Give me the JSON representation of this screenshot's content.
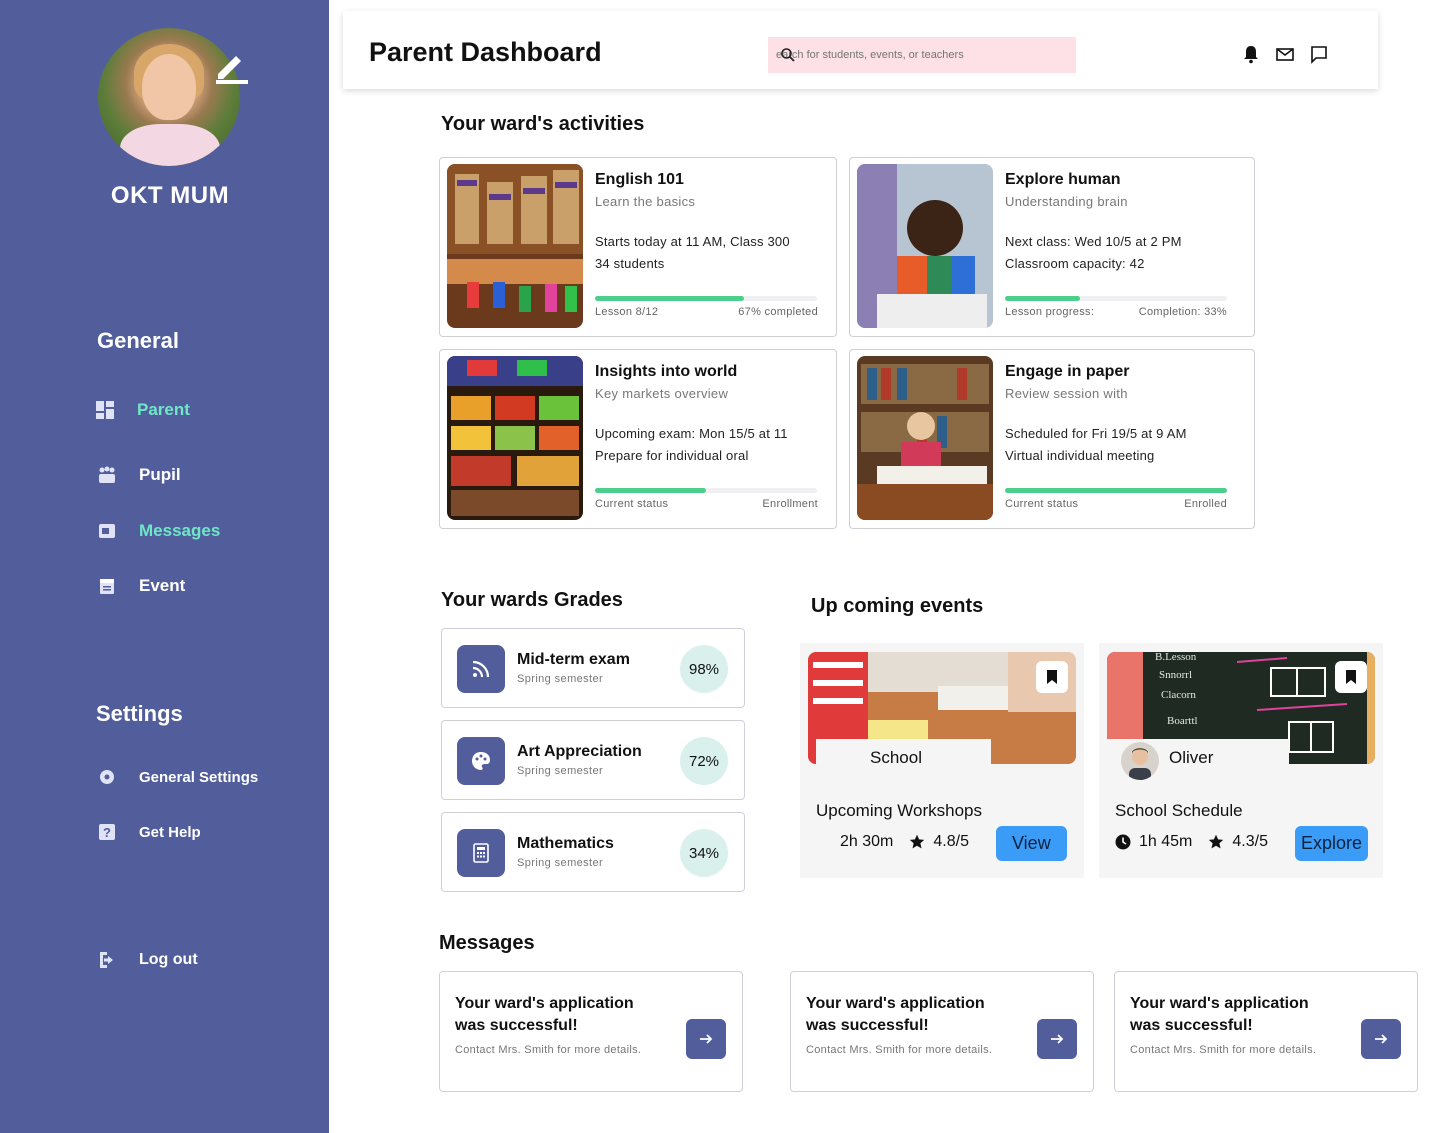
{
  "sidebar": {
    "profile_name": "OKT MUM",
    "general_title": "General",
    "nav": [
      {
        "label": "Parent",
        "icon": "dashboard-icon",
        "active": true
      },
      {
        "label": "Pupil",
        "icon": "group-icon",
        "active": false
      },
      {
        "label": "Messages",
        "icon": "messages-icon",
        "active": true
      },
      {
        "label": "Event",
        "icon": "calendar-icon",
        "active": false
      }
    ],
    "settings_title": "Settings",
    "settings": [
      {
        "label": "General Settings",
        "icon": "gear-icon"
      },
      {
        "label": "Get Help",
        "icon": "help-icon"
      }
    ],
    "logout_label": "Log out"
  },
  "header": {
    "title": "Parent Dashboard",
    "search_placeholder": "earch for students, events, or teachers"
  },
  "activities": {
    "title": "Your ward's activities",
    "items": [
      {
        "title": "English 101",
        "subtitle": "Learn the basics",
        "line1": "Starts today at 11 AM, Class 300",
        "line2": "34 students",
        "progress": 0.67,
        "foot_left": "Lesson 8/12",
        "foot_right": "67% completed"
      },
      {
        "title": "Explore human",
        "subtitle": "Understanding brain",
        "line1": "Next class: Wed 10/5 at 2 PM",
        "line2": "Classroom capacity: 42",
        "progress": 0.34,
        "foot_left": "Lesson progress:",
        "foot_right": "Completion: 33%"
      },
      {
        "title": "Insights into world",
        "subtitle": "Key markets overview",
        "line1": "Upcoming exam: Mon 15/5 at 11",
        "line2": "Prepare for individual oral",
        "progress": 0.5,
        "foot_left": "Current status",
        "foot_right": "Enrollment"
      },
      {
        "title": "Engage in paper",
        "subtitle": "Review session with",
        "line1": "Scheduled for Fri 19/5 at 9 AM",
        "line2": "Virtual individual meeting",
        "progress": 1.0,
        "foot_left": "Current status",
        "foot_right": "Enrolled"
      }
    ]
  },
  "grades": {
    "title": "Your wards Grades",
    "items": [
      {
        "title": "Mid-term exam",
        "subtitle": "Spring semester",
        "percent": "98%",
        "icon": "rss-icon"
      },
      {
        "title": "Art Appreciation",
        "subtitle": "Spring semester",
        "percent": "72%",
        "icon": "palette-icon"
      },
      {
        "title": "Mathematics",
        "subtitle": "Spring semester",
        "percent": "34%",
        "icon": "calculator-icon"
      }
    ]
  },
  "events": {
    "title": "Up coming events",
    "items": [
      {
        "label": "School",
        "name": "Upcoming Workshops",
        "duration": "2h 30m",
        "rating": "4.8/5",
        "button": "View"
      },
      {
        "label": "Oliver",
        "name": "School Schedule",
        "duration": "1h 45m",
        "rating": "4.3/5",
        "button": "Explore"
      }
    ]
  },
  "messages": {
    "title": "Messages",
    "items": [
      {
        "title": "Your ward's application was successful!",
        "body": "Contact Mrs. Smith for more details."
      },
      {
        "title": "Your ward's application was successful!",
        "body": "Contact Mrs. Smith for more details."
      },
      {
        "title": "Your ward's application was successful!",
        "body": "Contact Mrs. Smith for more details."
      }
    ]
  },
  "colors": {
    "sidebar": "#525e9c",
    "active_nav": "#6ee7c6",
    "progress": "#4ccf8b",
    "search_bg": "#fde1e6",
    "button_blue": "#3b9cf7"
  }
}
